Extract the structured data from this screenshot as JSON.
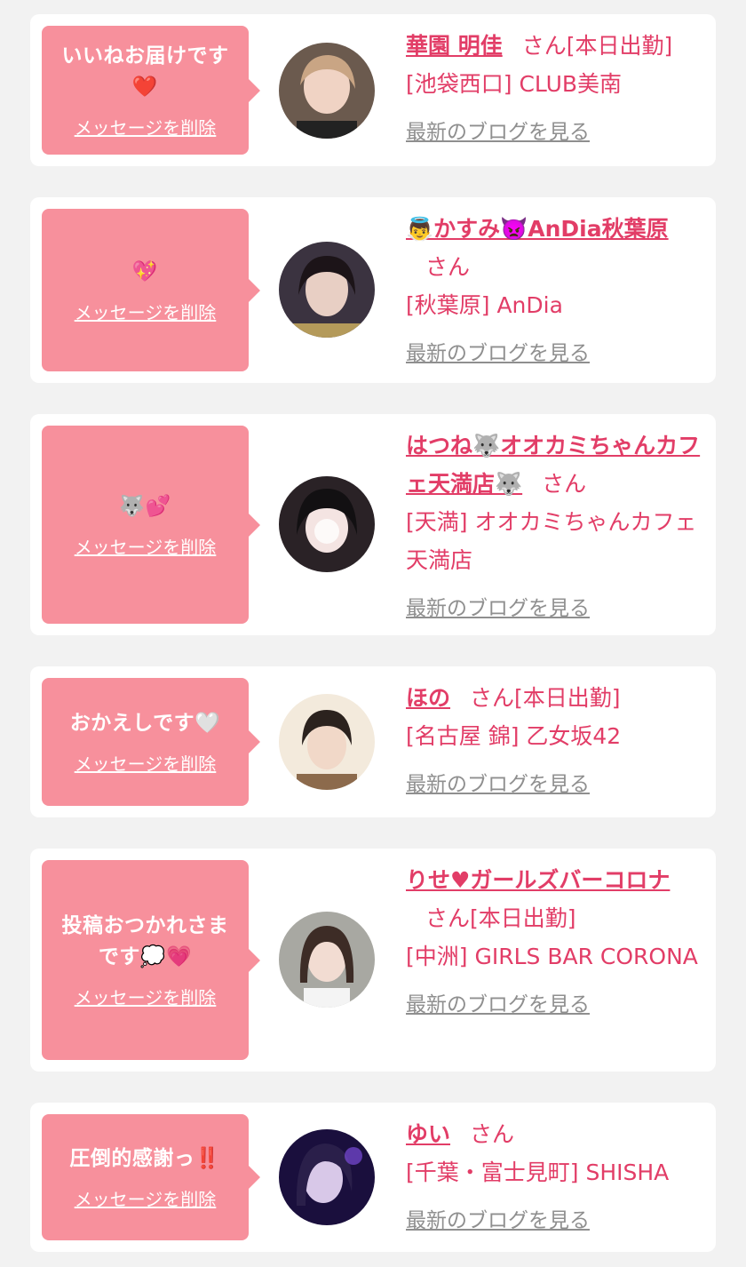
{
  "items": [
    {
      "message": "いいねお届けです\n❤️",
      "delete_label": "メッセージを削除",
      "name": "華園 明佳",
      "honorific": "さん",
      "status": "[本日出勤]",
      "shop": "[池袋西口] CLUB美南",
      "blog_label": "最新のブログを見る"
    },
    {
      "message": "💖",
      "delete_label": "メッセージを削除",
      "name": "👼かすみ👿AnDia秋葉原",
      "honorific": "さん",
      "status": "",
      "shop": "[秋葉原] AnDia",
      "blog_label": "最新のブログを見る"
    },
    {
      "message": "🐺💕",
      "delete_label": "メッセージを削除",
      "name": "はつね🐺オオカミちゃんカフェ天満店🐺",
      "honorific": "さん",
      "status": "",
      "shop": "[天満] オオカミちゃんカフェ天満店",
      "blog_label": "最新のブログを見る"
    },
    {
      "message": "おかえしです🤍",
      "delete_label": "メッセージを削除",
      "name": "ほの",
      "honorific": "さん",
      "status": "[本日出勤]",
      "shop": "[名古屋 錦] 乙女坂42",
      "blog_label": "最新のブログを見る"
    },
    {
      "message": "投稿おつかれさま\nです💭💗",
      "delete_label": "メッセージを削除",
      "name": "りせ♥ガールズバーコロナ",
      "honorific": "さん",
      "status": "[本日出勤]",
      "shop": "[中洲] GIRLS BAR CORONA",
      "blog_label": "最新のブログを見る"
    },
    {
      "message": "圧倒的感謝っ‼️",
      "delete_label": "メッセージを削除",
      "name": "ゆい",
      "honorific": "さん",
      "status": "",
      "shop": "[千葉・富士見町] SHISHA",
      "blog_label": "最新のブログを見る"
    }
  ],
  "colors": {
    "page_background": "#f2f2f2",
    "card_background": "#ffffff",
    "bubble": "#f7909c",
    "accent_text": "#e23d67",
    "muted_link": "#8f8f8f"
  }
}
